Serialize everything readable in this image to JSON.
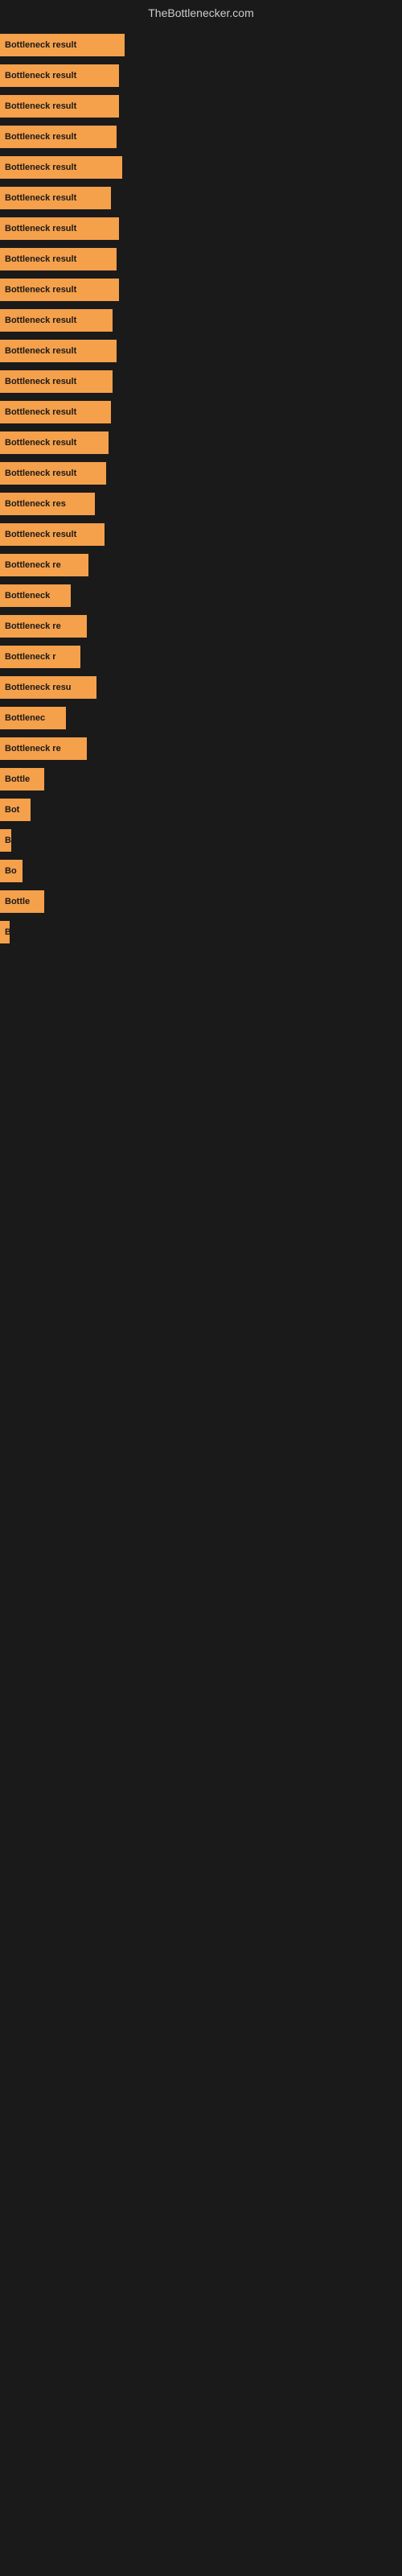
{
  "site": {
    "title": "TheBottlenecker.com"
  },
  "bars": [
    {
      "id": 1,
      "label": "Bottleneck result",
      "width": 155
    },
    {
      "id": 2,
      "label": "Bottleneck result",
      "width": 148
    },
    {
      "id": 3,
      "label": "Bottleneck result",
      "width": 148
    },
    {
      "id": 4,
      "label": "Bottleneck result",
      "width": 145
    },
    {
      "id": 5,
      "label": "Bottleneck result",
      "width": 152
    },
    {
      "id": 6,
      "label": "Bottleneck result",
      "width": 138
    },
    {
      "id": 7,
      "label": "Bottleneck result",
      "width": 148
    },
    {
      "id": 8,
      "label": "Bottleneck result",
      "width": 145
    },
    {
      "id": 9,
      "label": "Bottleneck result",
      "width": 148
    },
    {
      "id": 10,
      "label": "Bottleneck result",
      "width": 140
    },
    {
      "id": 11,
      "label": "Bottleneck result",
      "width": 145
    },
    {
      "id": 12,
      "label": "Bottleneck result",
      "width": 140
    },
    {
      "id": 13,
      "label": "Bottleneck result",
      "width": 138
    },
    {
      "id": 14,
      "label": "Bottleneck result",
      "width": 135
    },
    {
      "id": 15,
      "label": "Bottleneck result",
      "width": 132
    },
    {
      "id": 16,
      "label": "Bottleneck res",
      "width": 118
    },
    {
      "id": 17,
      "label": "Bottleneck result",
      "width": 130
    },
    {
      "id": 18,
      "label": "Bottleneck re",
      "width": 110
    },
    {
      "id": 19,
      "label": "Bottleneck",
      "width": 88
    },
    {
      "id": 20,
      "label": "Bottleneck re",
      "width": 108
    },
    {
      "id": 21,
      "label": "Bottleneck r",
      "width": 100
    },
    {
      "id": 22,
      "label": "Bottleneck resu",
      "width": 120
    },
    {
      "id": 23,
      "label": "Bottlenec",
      "width": 82
    },
    {
      "id": 24,
      "label": "Bottleneck re",
      "width": 108
    },
    {
      "id": 25,
      "label": "Bottle",
      "width": 55
    },
    {
      "id": 26,
      "label": "Bot",
      "width": 38
    },
    {
      "id": 27,
      "label": "B",
      "width": 14
    },
    {
      "id": 28,
      "label": "Bo",
      "width": 28
    },
    {
      "id": 29,
      "label": "Bottle",
      "width": 55
    },
    {
      "id": 30,
      "label": "B",
      "width": 12
    },
    {
      "id": 31,
      "label": "",
      "width": 0
    },
    {
      "id": 32,
      "label": "",
      "width": 0
    },
    {
      "id": 33,
      "label": "",
      "width": 0
    },
    {
      "id": 34,
      "label": "",
      "width": 0
    },
    {
      "id": 35,
      "label": "",
      "width": 0
    }
  ]
}
